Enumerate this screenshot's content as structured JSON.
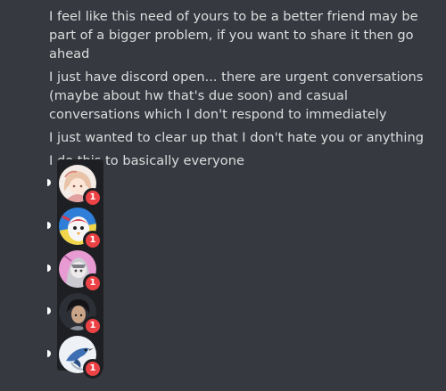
{
  "messages": [
    "I feel like this need of yours to be a better friend may be part of a bigger problem, if you want to share it then go ahead",
    "I just have discord open... there are urgent conversations (maybe about hw that's due soon) and casual conversations which I don't respond to immediately",
    "I just wanted to clear up that I don't hate you or anything",
    "I do this to basically everyone"
  ],
  "dm_list": {
    "items": [
      {
        "badge": "1",
        "icon": "anime-girl-avatar-icon"
      },
      {
        "badge": "1",
        "icon": "penguin-avatar-icon"
      },
      {
        "badge": "1",
        "icon": "pink-character-avatar-icon"
      },
      {
        "badge": "1",
        "icon": "dark-hair-boy-avatar-icon"
      },
      {
        "badge": "1",
        "icon": "bird-avatar-icon"
      }
    ]
  },
  "colors": {
    "background": "#36393f",
    "text": "#dcddde",
    "dm_bar": "#1e1f22",
    "badge": "#ed4245"
  }
}
